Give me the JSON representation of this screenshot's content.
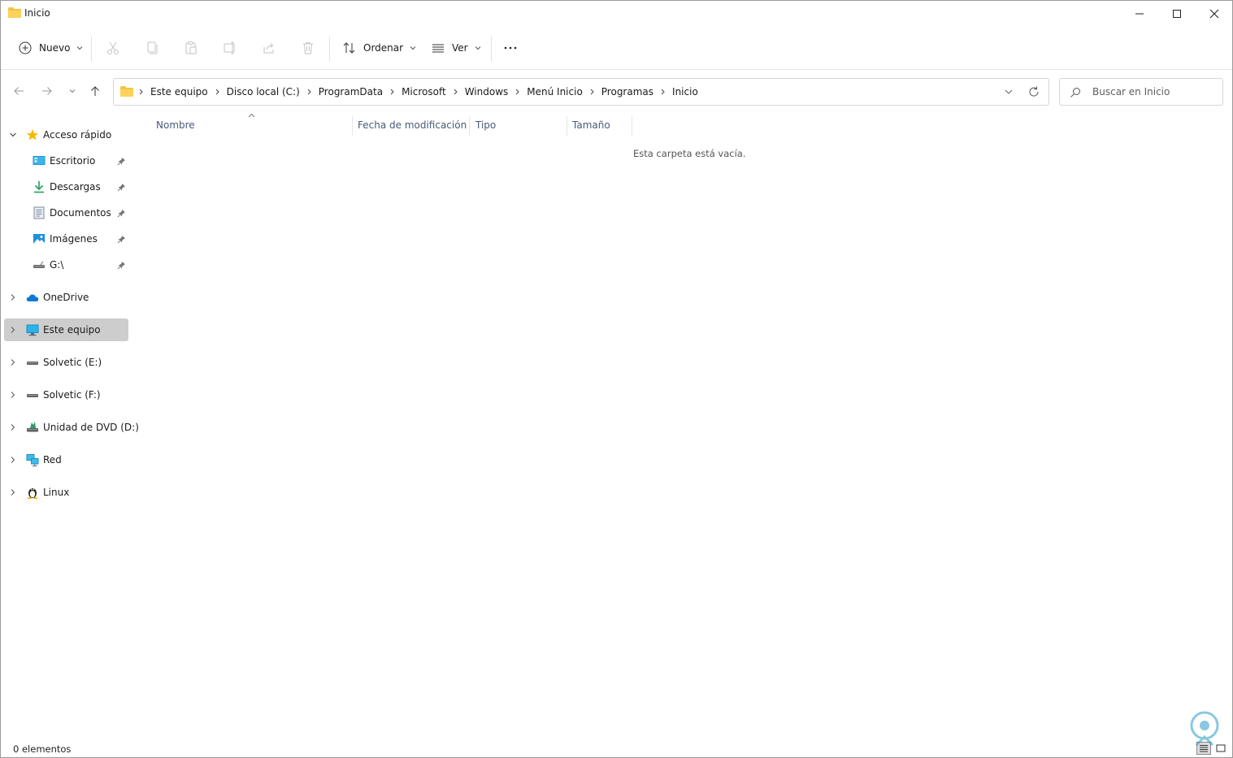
{
  "window": {
    "title": "Inicio"
  },
  "toolbar": {
    "new_label": "Nuevo",
    "sort_label": "Ordenar",
    "view_label": "Ver",
    "more_label": "..."
  },
  "address": {
    "crumbs": [
      "Este equipo",
      "Disco local (C:)",
      "ProgramData",
      "Microsoft",
      "Windows",
      "Menú Inicio",
      "Programas",
      "Inicio"
    ]
  },
  "search": {
    "placeholder": "Buscar en Inicio"
  },
  "sidebar": {
    "quick_access": "Acceso rápido",
    "quick_items": [
      {
        "label": "Escritorio",
        "icon": "desktop-icon"
      },
      {
        "label": "Descargas",
        "icon": "download-icon"
      },
      {
        "label": "Documentos",
        "icon": "documents-icon"
      },
      {
        "label": "Imágenes",
        "icon": "pictures-icon"
      },
      {
        "label": "G:\\",
        "icon": "drive-icon"
      }
    ],
    "roots": [
      {
        "label": "OneDrive",
        "icon": "cloud-icon"
      },
      {
        "label": "Este equipo",
        "icon": "computer-icon",
        "selected": true
      },
      {
        "label": "Solvetic (E:)",
        "icon": "drive-icon"
      },
      {
        "label": "Solvetic (F:)",
        "icon": "drive-icon"
      },
      {
        "label": "Unidad de DVD (D:)",
        "icon": "dvd-icon"
      },
      {
        "label": "Red",
        "icon": "network-icon"
      },
      {
        "label": "Linux",
        "icon": "linux-icon"
      }
    ]
  },
  "columns": {
    "name": "Nombre",
    "modified": "Fecha de modificación",
    "type": "Tipo",
    "size": "Tamaño"
  },
  "content": {
    "empty_message": "Esta carpeta está vacía."
  },
  "statusbar": {
    "count": "0 elementos"
  },
  "colors": {
    "folder": "#f6c342",
    "accent": "#0078d4",
    "selected_bg": "#cdcdcd"
  }
}
